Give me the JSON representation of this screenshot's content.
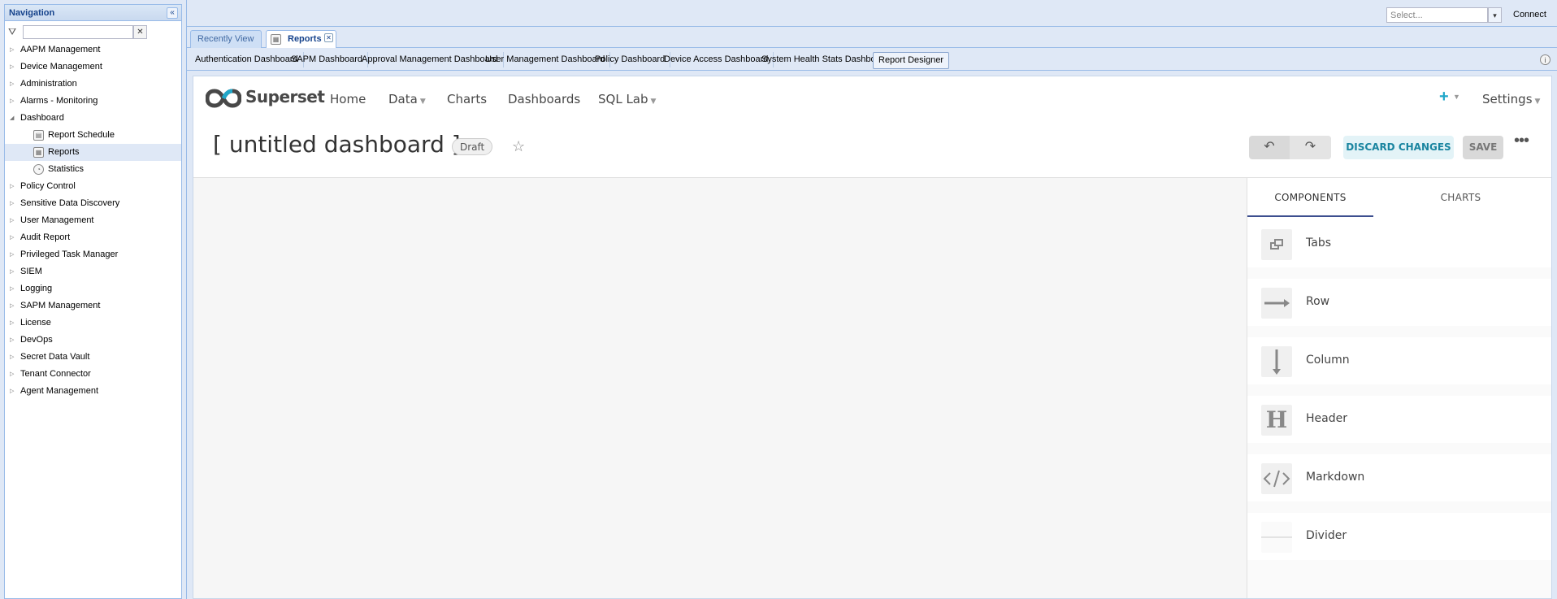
{
  "nav": {
    "title": "Navigation",
    "search_placeholder": "",
    "items": [
      {
        "label": "AAPM Management",
        "expanded": false
      },
      {
        "label": "Device Management",
        "expanded": false
      },
      {
        "label": "Administration",
        "expanded": false
      },
      {
        "label": "Alarms - Monitoring",
        "expanded": false
      },
      {
        "label": "Dashboard",
        "expanded": true
      },
      {
        "label": "Report Schedule",
        "child": true
      },
      {
        "label": "Reports",
        "child": true,
        "selected": true
      },
      {
        "label": "Statistics",
        "child": true
      },
      {
        "label": "Policy Control",
        "expanded": false
      },
      {
        "label": "Sensitive Data Discovery",
        "expanded": false
      },
      {
        "label": "User Management",
        "expanded": false
      },
      {
        "label": "Audit Report",
        "expanded": false
      },
      {
        "label": "Privileged Task Manager",
        "expanded": false
      },
      {
        "label": "SIEM",
        "expanded": false
      },
      {
        "label": "Logging",
        "expanded": false
      },
      {
        "label": "SAPM Management",
        "expanded": false
      },
      {
        "label": "License",
        "expanded": false
      },
      {
        "label": "DevOps",
        "expanded": false
      },
      {
        "label": "Secret Data Vault",
        "expanded": false
      },
      {
        "label": "Tenant Connector",
        "expanded": false
      },
      {
        "label": "Agent Management",
        "expanded": false
      }
    ]
  },
  "topbar": {
    "select_placeholder": "Select...",
    "connect_label": "Connect"
  },
  "tabs": {
    "recent": "Recently View",
    "reports": "Reports"
  },
  "dashboards": [
    "Authentication Dashboard",
    "SAPM Dashboard",
    "Approval Management Dashboard",
    "User Management Dashboard",
    "Policy Dashboard",
    "Device Access Dashboard",
    "System Health Stats Dashboard",
    "Report Designer"
  ],
  "superset": {
    "brand": "Superset",
    "menu": {
      "home": "Home",
      "data": "Data",
      "charts": "Charts",
      "dashboards": "Dashboards",
      "sqllab": "SQL Lab"
    },
    "plus": "+",
    "settings": "Settings",
    "dashboard_title": "[ untitled dashboard ]",
    "draft": "Draft",
    "discard": "DISCARD CHANGES",
    "save": "SAVE",
    "builder_tabs": {
      "components": "COMPONENTS",
      "charts": "CHARTS"
    },
    "components": [
      {
        "label": "Tabs",
        "icon": "tabs-icon"
      },
      {
        "label": "Row",
        "icon": "row-icon"
      },
      {
        "label": "Column",
        "icon": "column-icon"
      },
      {
        "label": "Header",
        "icon": "header-icon"
      },
      {
        "label": "Markdown",
        "icon": "markdown-icon"
      },
      {
        "label": "Divider",
        "icon": "divider-icon"
      }
    ]
  }
}
